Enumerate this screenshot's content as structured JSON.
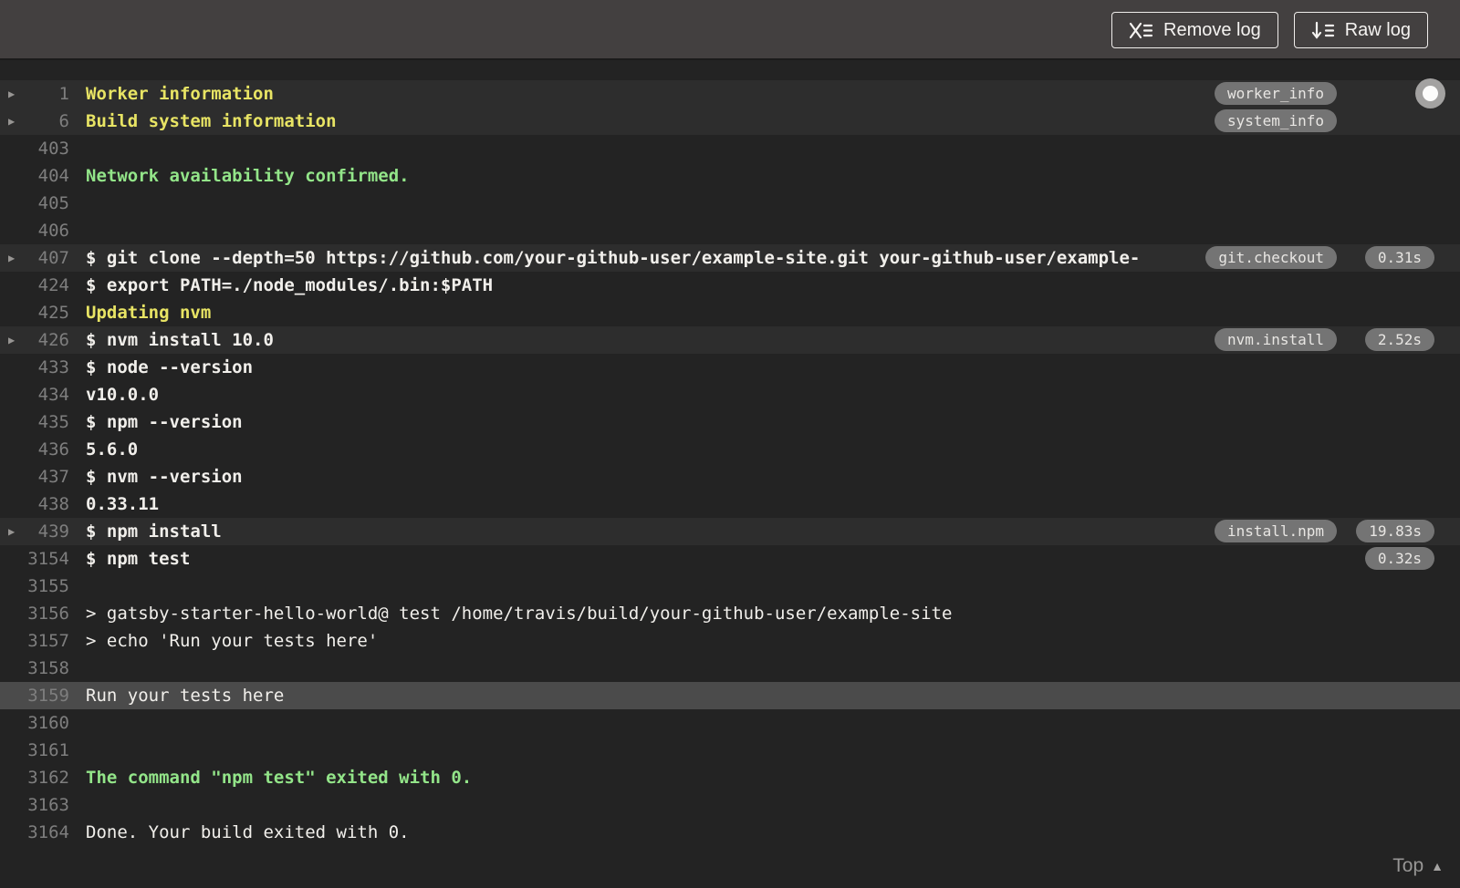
{
  "toolbar": {
    "remove_log_label": "Remove log",
    "raw_log_label": "Raw log",
    "remove_log_icon": "x-list-icon",
    "raw_log_icon": "arrow-down-list-icon"
  },
  "colors": {
    "topbar_bg": "#434040",
    "log_bg": "#232323",
    "fold_row_bg": "#2d2d2d",
    "selected_row_bg": "#4b4b4b",
    "text_default": "#f1efeb",
    "text_yellow": "#e8e464",
    "text_green": "#93e589",
    "line_number": "#7e7e7e",
    "badge_bg": "#747474"
  },
  "scroll_indicator": {
    "icon": "scroll-position-dot"
  },
  "footer": {
    "top_label": "Top",
    "top_icon": "▲"
  },
  "log": {
    "fold_icon": "▶",
    "lines": [
      {
        "num": "1",
        "text": "Worker information",
        "style": "yellow",
        "bold": true,
        "fold": true,
        "bg": "fold",
        "tag": "worker_info",
        "duration": null
      },
      {
        "num": "6",
        "text": "Build system information",
        "style": "yellow",
        "bold": true,
        "fold": true,
        "bg": "fold",
        "tag": "system_info",
        "duration": null
      },
      {
        "num": "403",
        "text": "",
        "style": "white",
        "bold": false,
        "fold": false,
        "bg": null,
        "tag": null,
        "duration": null
      },
      {
        "num": "404",
        "text": "Network availability confirmed.",
        "style": "green",
        "bold": true,
        "fold": false,
        "bg": null,
        "tag": null,
        "duration": null
      },
      {
        "num": "405",
        "text": "",
        "style": "white",
        "bold": false,
        "fold": false,
        "bg": null,
        "tag": null,
        "duration": null
      },
      {
        "num": "406",
        "text": "",
        "style": "white",
        "bold": false,
        "fold": false,
        "bg": null,
        "tag": null,
        "duration": null
      },
      {
        "num": "407",
        "text": "$ git clone --depth=50 https://github.com/your-github-user/example-site.git your-github-user/example-",
        "style": "white",
        "bold": true,
        "fold": true,
        "bg": "fold",
        "tag": "git.checkout",
        "duration": "0.31s"
      },
      {
        "num": "424",
        "text": "$ export PATH=./node_modules/.bin:$PATH",
        "style": "white",
        "bold": true,
        "fold": false,
        "bg": null,
        "tag": null,
        "duration": null
      },
      {
        "num": "425",
        "text": "Updating nvm",
        "style": "yellow",
        "bold": true,
        "fold": false,
        "bg": null,
        "tag": null,
        "duration": null
      },
      {
        "num": "426",
        "text": "$ nvm install 10.0",
        "style": "white",
        "bold": true,
        "fold": true,
        "bg": "fold",
        "tag": "nvm.install",
        "duration": "2.52s"
      },
      {
        "num": "433",
        "text": "$ node --version",
        "style": "white",
        "bold": true,
        "fold": false,
        "bg": null,
        "tag": null,
        "duration": null
      },
      {
        "num": "434",
        "text": "v10.0.0",
        "style": "white",
        "bold": true,
        "fold": false,
        "bg": null,
        "tag": null,
        "duration": null
      },
      {
        "num": "435",
        "text": "$ npm --version",
        "style": "white",
        "bold": true,
        "fold": false,
        "bg": null,
        "tag": null,
        "duration": null
      },
      {
        "num": "436",
        "text": "5.6.0",
        "style": "white",
        "bold": true,
        "fold": false,
        "bg": null,
        "tag": null,
        "duration": null
      },
      {
        "num": "437",
        "text": "$ nvm --version",
        "style": "white",
        "bold": true,
        "fold": false,
        "bg": null,
        "tag": null,
        "duration": null
      },
      {
        "num": "438",
        "text": "0.33.11",
        "style": "white",
        "bold": true,
        "fold": false,
        "bg": null,
        "tag": null,
        "duration": null
      },
      {
        "num": "439",
        "text": "$ npm install",
        "style": "white",
        "bold": true,
        "fold": true,
        "bg": "fold",
        "tag": "install.npm",
        "duration": "19.83s"
      },
      {
        "num": "3154",
        "text": "$ npm test",
        "style": "white",
        "bold": true,
        "fold": false,
        "bg": null,
        "tag": null,
        "duration": "0.32s"
      },
      {
        "num": "3155",
        "text": "",
        "style": "white",
        "bold": false,
        "fold": false,
        "bg": null,
        "tag": null,
        "duration": null
      },
      {
        "num": "3156",
        "text": "> gatsby-starter-hello-world@ test /home/travis/build/your-github-user/example-site",
        "style": "white",
        "bold": false,
        "fold": false,
        "bg": null,
        "tag": null,
        "duration": null
      },
      {
        "num": "3157",
        "text": "> echo 'Run your tests here'",
        "style": "white",
        "bold": false,
        "fold": false,
        "bg": null,
        "tag": null,
        "duration": null
      },
      {
        "num": "3158",
        "text": "",
        "style": "white",
        "bold": false,
        "fold": false,
        "bg": null,
        "tag": null,
        "duration": null
      },
      {
        "num": "3159",
        "text": "Run your tests here",
        "style": "white",
        "bold": false,
        "fold": false,
        "bg": "selected",
        "tag": null,
        "duration": null
      },
      {
        "num": "3160",
        "text": "",
        "style": "white",
        "bold": false,
        "fold": false,
        "bg": null,
        "tag": null,
        "duration": null
      },
      {
        "num": "3161",
        "text": "",
        "style": "white",
        "bold": false,
        "fold": false,
        "bg": null,
        "tag": null,
        "duration": null
      },
      {
        "num": "3162",
        "text": "The command \"npm test\" exited with 0.",
        "style": "green",
        "bold": true,
        "fold": false,
        "bg": null,
        "tag": null,
        "duration": null
      },
      {
        "num": "3163",
        "text": "",
        "style": "white",
        "bold": false,
        "fold": false,
        "bg": null,
        "tag": null,
        "duration": null
      },
      {
        "num": "3164",
        "text": "Done. Your build exited with 0.",
        "style": "white",
        "bold": false,
        "fold": false,
        "bg": null,
        "tag": null,
        "duration": null
      }
    ]
  }
}
